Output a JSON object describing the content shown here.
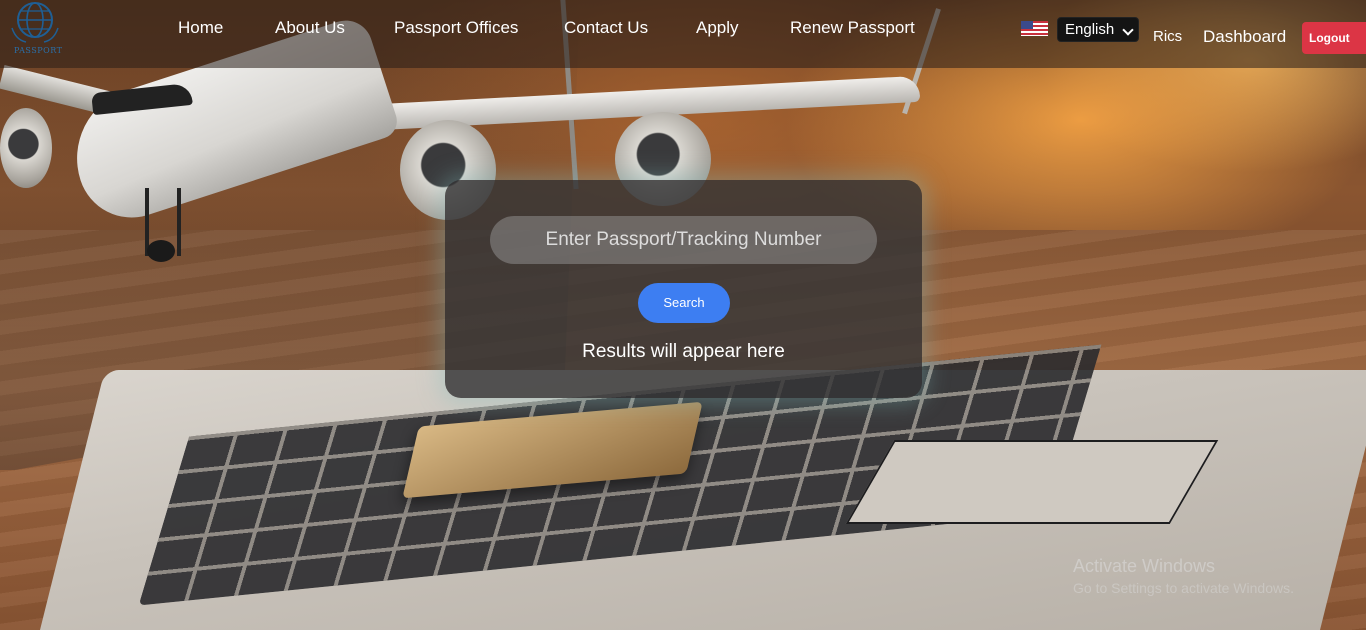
{
  "nav": {
    "logo_text": "PASSPORT",
    "links": [
      {
        "label": "Home"
      },
      {
        "label": "About Us"
      },
      {
        "label": "Passport Offices"
      },
      {
        "label": "Contact Us"
      },
      {
        "label": "Apply"
      },
      {
        "label": "Renew Passport"
      }
    ],
    "language": {
      "flag_icon": "us-flag-icon",
      "selected": "English"
    },
    "user_name": "Rics",
    "dashboard_label": "Dashboard",
    "logout_label": "Logout"
  },
  "search": {
    "placeholder": "Enter Passport/Tracking Number",
    "button_label": "Search",
    "results_text": "Results will appear here"
  },
  "watermark": {
    "title": "Activate Windows",
    "subtitle": "Go to Settings to activate Windows."
  },
  "colors": {
    "logout": "#dc3545",
    "search_button": "#3d7ef2",
    "card_background": "#343436"
  }
}
